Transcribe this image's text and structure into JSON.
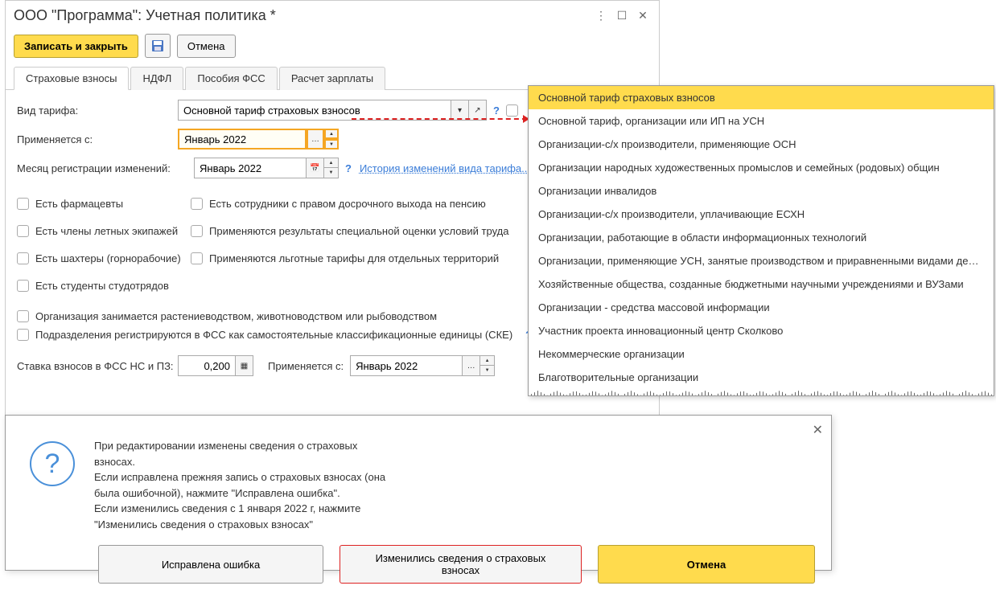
{
  "window": {
    "title": "ООО \"Программа\": Учетная политика *"
  },
  "toolbar": {
    "save_close": "Записать и закрыть",
    "cancel": "Отмена"
  },
  "tabs": [
    {
      "label": "Страховые взносы",
      "active": true
    },
    {
      "label": "НДФЛ",
      "active": false
    },
    {
      "label": "Пособия ФСС",
      "active": false
    },
    {
      "label": "Расчет зарплаты",
      "active": false
    }
  ],
  "form": {
    "tariff_type_label": "Вид тарифа:",
    "tariff_type_value": "Основной тариф страховых взносов",
    "applied_from_label": "Применяется с:",
    "applied_from_value": "Январь 2022",
    "reg_month_label": "Месяц регистрации изменений:",
    "reg_month_value": "Январь 2022",
    "history_link": "История изменений вида тарифа...",
    "checks_left": [
      {
        "label": "Есть фармацевты"
      },
      {
        "label": "Есть члены летных экипажей"
      },
      {
        "label": "Есть шахтеры (горнорабочие)"
      },
      {
        "label": "Есть студенты студотрядов"
      }
    ],
    "checks_right": [
      {
        "label": "Есть сотрудники с правом досрочного выхода на пенсию"
      },
      {
        "label": "Применяются результаты специальной оценки условий труда"
      },
      {
        "label": "Применяются льготные тарифы для отдельных территорий"
      }
    ],
    "plant_check": "Организация занимается растениеводством, животноводством или рыбоводством",
    "fss_check": "Подразделения регистрируются в ФСС как самостоятельные классификационные единицы (СКЕ)",
    "fss_rate_label": "Ставка взносов в ФСС НС и ПЗ:",
    "fss_rate_value": "0,200",
    "fss_applied_label": "Применяется с:",
    "fss_applied_value": "Январь 2022"
  },
  "dropdown_items": [
    "Основной тариф страховых взносов",
    "Основной тариф, организации или ИП на УСН",
    "Организации-с/х производители, применяющие ОСН",
    "Организации народных художественных промыслов и семейных (родовых) общин",
    "Организации инвалидов",
    "Организации-с/х производители, уплачивающие ЕСХН",
    "Организации, работающие в области информационных технологий",
    "Организации, применяющие УСН, занятые производством и приравненными видами деятель...",
    "Хозяйственные общества, созданные бюджетными научными учреждениями и ВУЗами",
    "Организации - средства массовой информации",
    "Участник проекта инновационный центр Сколково",
    "Некоммерческие организации",
    "Благотворительные организации"
  ],
  "dialog": {
    "text_lines": [
      "При редактировании изменены сведения о страховых взносах.",
      "Если исправлена прежняя запись о страховых взносах (она была ошибочной), нажмите \"Исправлена ошибка\".",
      "Если изменились сведения с 1 января 2022 г, нажмите \"Изменились сведения о страховых взносах\""
    ],
    "btn_fixed": "Исправлена ошибка",
    "btn_changed": "Изменились сведения о страховых взносах",
    "btn_cancel": "Отмена"
  }
}
